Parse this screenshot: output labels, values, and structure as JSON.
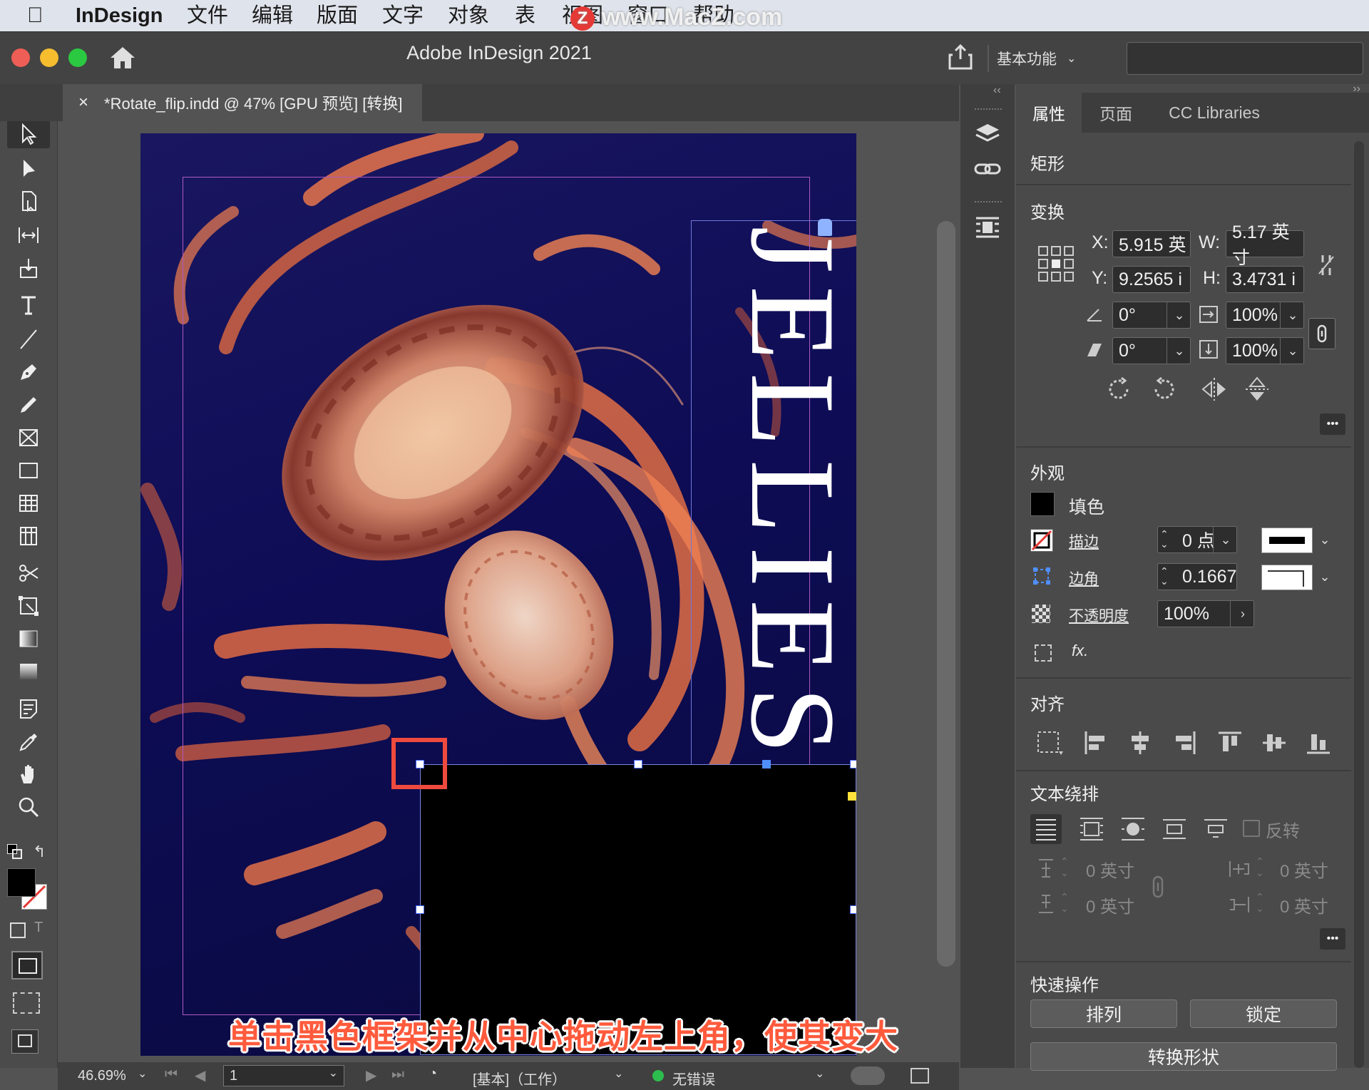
{
  "menubar": {
    "app": "InDesign",
    "items": [
      "文件",
      "编辑",
      "版面",
      "文字",
      "对象",
      "表",
      "视图",
      "窗口",
      "帮助"
    ],
    "watermark": "www.MacZ.com"
  },
  "titlebar": {
    "title": "Adobe InDesign 2021",
    "workspace": "基本功能"
  },
  "document_tab": {
    "close": "×",
    "title": "*Rotate_flip.indd @ 47% [GPU 预览] [转换]"
  },
  "artwork": {
    "headline": "JELLIES"
  },
  "right_panel": {
    "tabs": [
      "属性",
      "页面",
      "CC Libraries"
    ],
    "object_type": "矩形",
    "transform": {
      "title": "变换",
      "x_label": "X:",
      "x_value": "5.915 英",
      "y_label": "Y:",
      "y_value": "9.2565 i",
      "w_label": "W:",
      "w_value": "5.17 英寸",
      "h_label": "H:",
      "h_value": "3.4731 i",
      "rotate_value": "0°",
      "shear_value": "0°",
      "scale_x_value": "100%",
      "scale_y_value": "100%"
    },
    "appearance": {
      "title": "外观",
      "fill_label": "填色",
      "stroke_label": "描边",
      "stroke_value": "0 点",
      "corner_label": "边角",
      "corner_value": "0.1667",
      "opacity_label": "不透明度",
      "opacity_value": "100%",
      "fx_label": "fx."
    },
    "align": {
      "title": "对齐"
    },
    "text_wrap": {
      "title": "文本绕排",
      "invert_label": "反转",
      "top_offset": "0 英寸",
      "bottom_offset": "0 英寸",
      "left_offset": "0 英寸",
      "right_offset": "0 英寸"
    },
    "quick_actions": {
      "title": "快速操作",
      "arrange": "排列",
      "lock": "锁定",
      "convert_shape": "转换形状"
    },
    "more": "•••"
  },
  "statusbar": {
    "zoom": "46.69%",
    "page": "1",
    "master": "[基本]（工作）",
    "errors": "无错误"
  },
  "caption": "单击黑色框架并从中心拖动左上角，使其变大",
  "colors": {
    "accent_red": "#e8493a",
    "frame_black": "#000000",
    "page_navy": "#0d0c55",
    "ok_green": "#2dbd4e"
  }
}
